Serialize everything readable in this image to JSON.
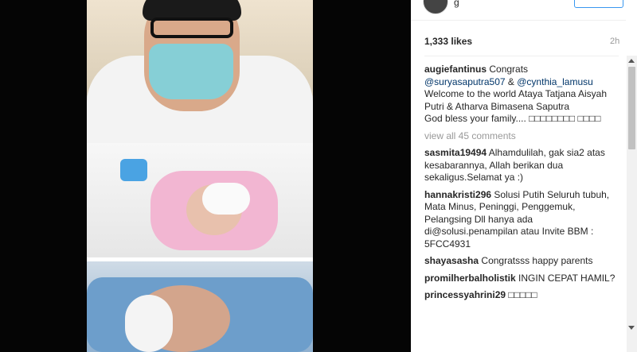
{
  "post": {
    "username_partial": "g",
    "likes": "1,333 likes",
    "time": "2h"
  },
  "comments": [
    {
      "user": "augiefantinus",
      "text_before": " Congrats",
      "mention1": "@suryasaputra507",
      "middle": " & ",
      "mention2": "@cynthia_lamusu",
      "text_after": " Welcome to the world Ataya Tatjana Aisyah Putri & Atharva Bimasena Saputra",
      "text_last": "God bless your family.... □□□□□□□□ □□□□"
    }
  ],
  "view_all": "view all 45 comments",
  "more_comments": [
    {
      "user": "sasmita19494",
      "text": " Alhamdulilah, gak sia2 atas kesabarannya, Allah berikan dua sekaligus.Selamat ya :)"
    },
    {
      "user": "hannakristi296",
      "text": " Solusi Putih Seluruh tubuh, Mata Minus, Peninggi, Penggemuk, Pelangsing Dll hanya ada di@solusi.penampilan atau Invite BBM : 5FCC4931"
    },
    {
      "user": "shayasasha",
      "text": " Congratsss happy parents"
    },
    {
      "user": "promilherbalholistik",
      "text": " INGIN CEPAT HAMIL?"
    },
    {
      "user": "princessyahrini29",
      "text": " □□□□□"
    }
  ],
  "icons": {
    "avatar": "user-avatar",
    "scroll_up": "triangle-up-icon",
    "scroll_down": "triangle-down-icon"
  },
  "colors": {
    "mention": "#003569",
    "follow": "#3897f0"
  }
}
